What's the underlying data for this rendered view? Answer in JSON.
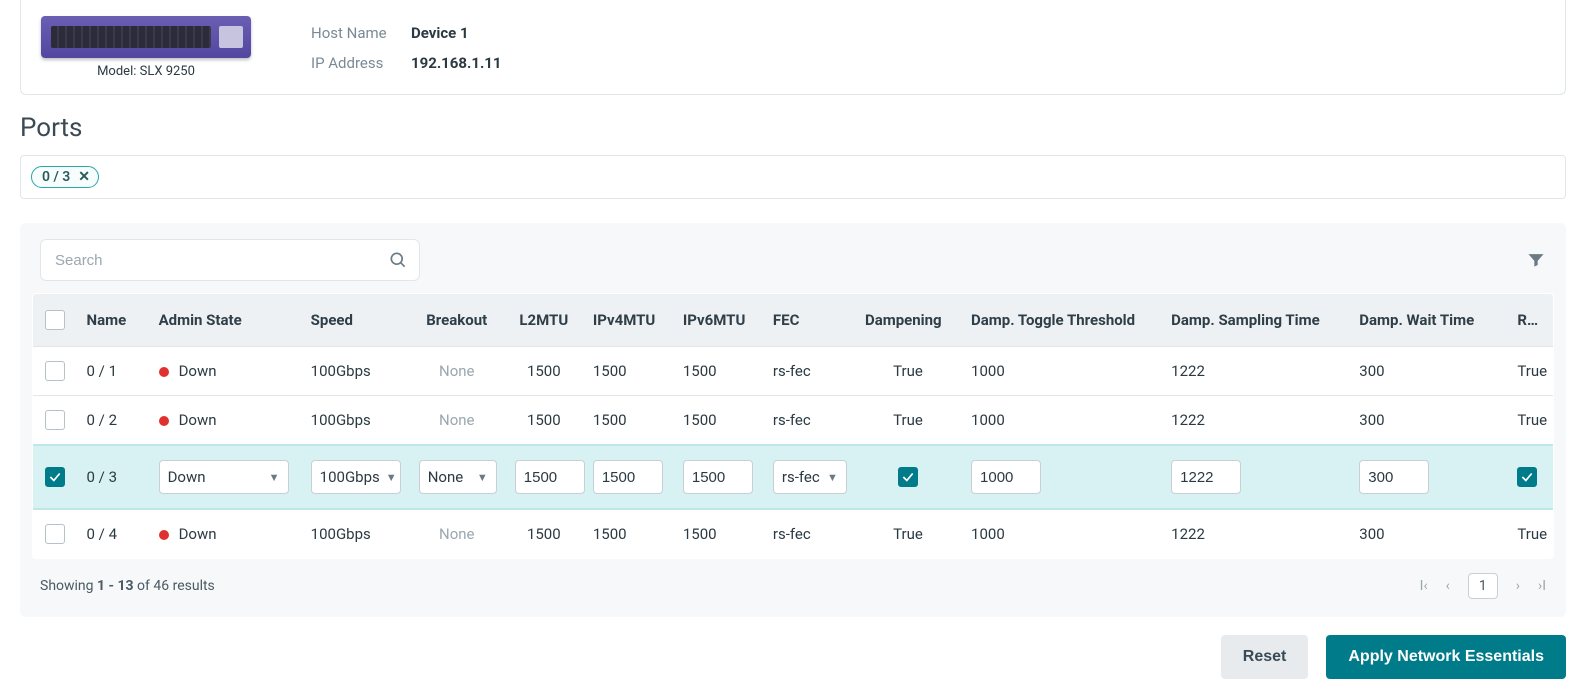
{
  "device": {
    "model_label": "Model: SLX 9250",
    "host_name_label": "Host Name",
    "host_name": "Device 1",
    "ip_label": "IP Address",
    "ip": "192.168.1.11"
  },
  "section_title": "Ports",
  "chip": {
    "label": "0 / 3"
  },
  "search": {
    "placeholder": "Search"
  },
  "columns": {
    "name": "Name",
    "admin_state": "Admin State",
    "speed": "Speed",
    "breakout": "Breakout",
    "l2mtu": "L2MTU",
    "ipv4mtu": "IPv4MTU",
    "ipv6mtu": "IPv6MTU",
    "fec": "FEC",
    "dampening": "Dampening",
    "dtt": "Damp. Toggle Threshold",
    "dst": "Damp. Sampling Time",
    "dwt": "Damp. Wait Time",
    "rme": "RME"
  },
  "rows": [
    {
      "name": "0 / 1",
      "admin_state": "Down",
      "status": "red",
      "speed": "100Gbps",
      "breakout": "None",
      "l2mtu": "1500",
      "ipv4mtu": "1500",
      "ipv6mtu": "1500",
      "fec": "rs-fec",
      "dampening": "True",
      "dtt": "1000",
      "dst": "1222",
      "dwt": "300",
      "rme": "True",
      "selected": false
    },
    {
      "name": "0 / 2",
      "admin_state": "Down",
      "status": "red",
      "speed": "100Gbps",
      "breakout": "None",
      "l2mtu": "1500",
      "ipv4mtu": "1500",
      "ipv6mtu": "1500",
      "fec": "rs-fec",
      "dampening": "True",
      "dtt": "1000",
      "dst": "1222",
      "dwt": "300",
      "rme": "True",
      "selected": false
    },
    {
      "name": "0 / 3",
      "admin_state": "Down",
      "status": "red",
      "speed": "100Gbps",
      "breakout": "None",
      "l2mtu": "1500",
      "ipv4mtu": "1500",
      "ipv6mtu": "1500",
      "fec": "rs-fec",
      "dampening": true,
      "dtt": "1000",
      "dst": "1222",
      "dwt": "300",
      "rme": true,
      "selected": true
    },
    {
      "name": "0 / 4",
      "admin_state": "Down",
      "status": "red",
      "speed": "100Gbps",
      "breakout": "None",
      "l2mtu": "1500",
      "ipv4mtu": "1500",
      "ipv6mtu": "1500",
      "fec": "rs-fec",
      "dampening": "True",
      "dtt": "1000",
      "dst": "1222",
      "dwt": "300",
      "rme": "True",
      "selected": false
    }
  ],
  "footer": {
    "prefix": "Showing ",
    "range": "1 - 13",
    "mid": " of 46 results",
    "page": "1"
  },
  "buttons": {
    "reset": "Reset",
    "apply": "Apply Network Essentials"
  }
}
